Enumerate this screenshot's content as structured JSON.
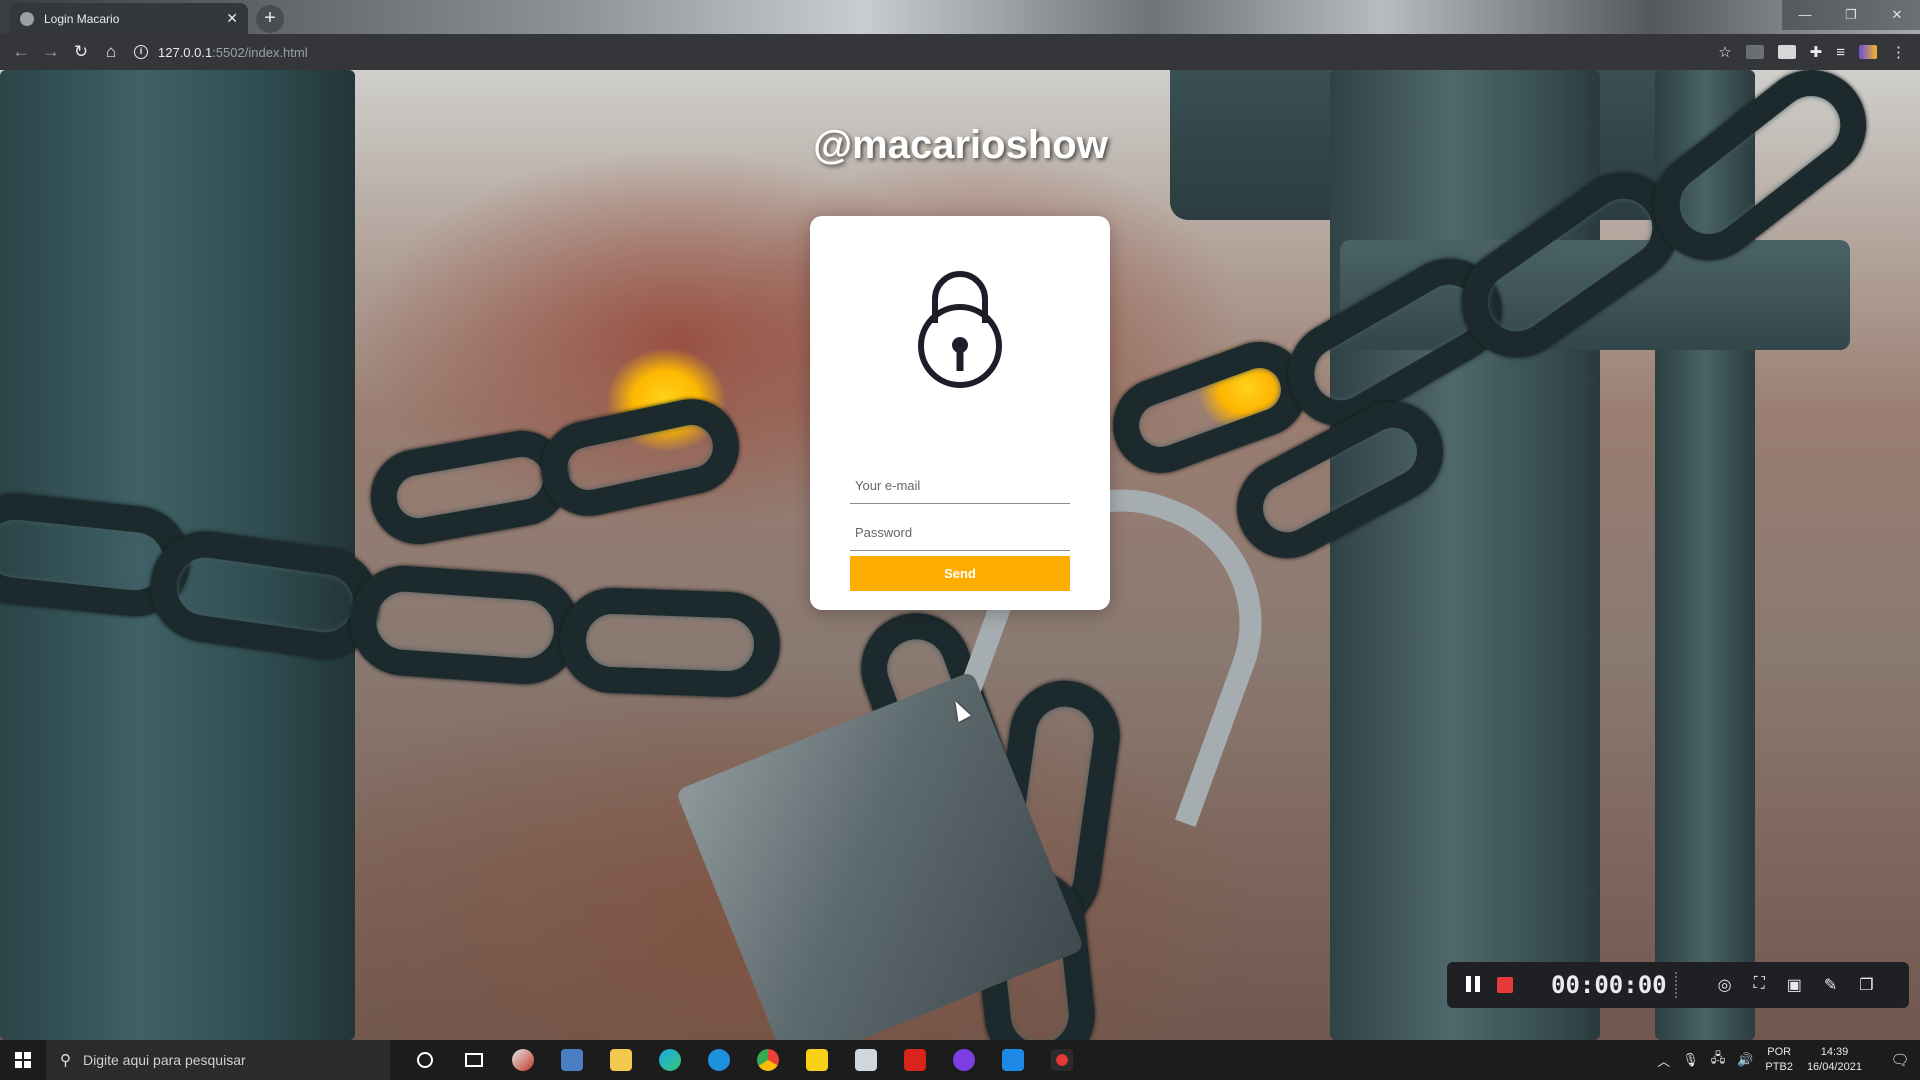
{
  "browser": {
    "tab_title": "Login Macario",
    "tab_close": "✕",
    "new_tab": "+",
    "url_host": "127.0.0.1",
    "url_path": ":5502/index.html",
    "window_controls": [
      "—",
      "❐",
      "✕"
    ]
  },
  "page": {
    "brand": "@macarioshow",
    "email_placeholder": "Your e-mail",
    "password_placeholder": "Password",
    "send_label": "Send",
    "accent_color": "#ffac00"
  },
  "recorder": {
    "time": "00:00:00"
  },
  "taskbar": {
    "search_placeholder": "Digite aqui para pesquisar",
    "language_line1": "POR",
    "language_line2": "PTB2",
    "time": "14:39",
    "date": "16/04/2021"
  }
}
